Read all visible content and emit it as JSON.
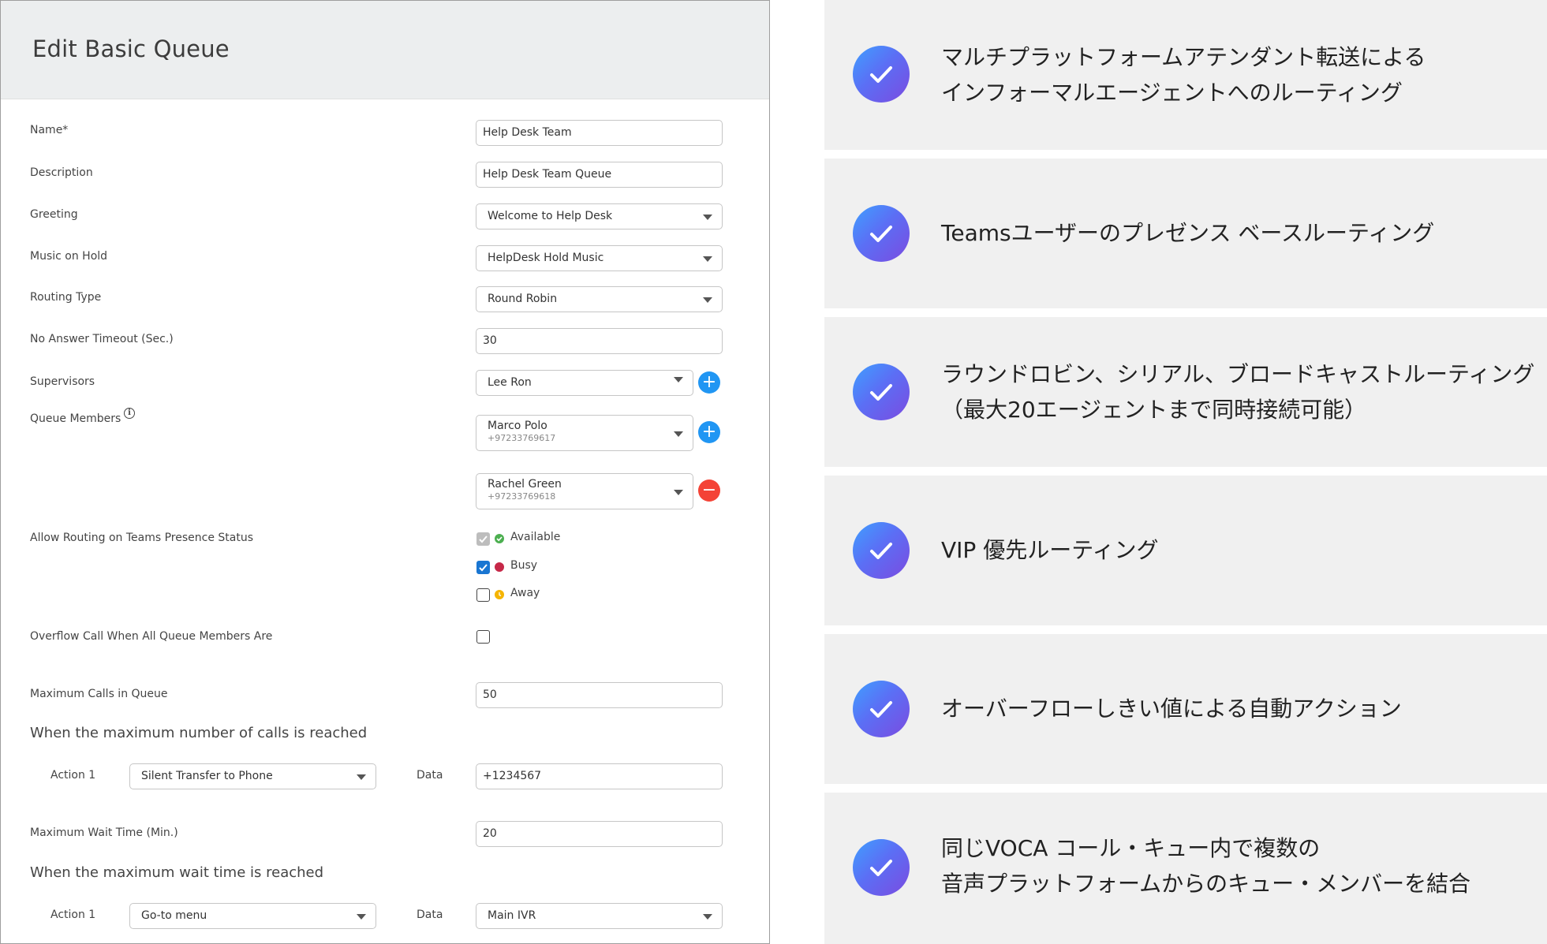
{
  "form": {
    "title": "Edit Basic Queue",
    "name_label": "Name*",
    "name_value": "Help Desk Team",
    "description_label": "Description",
    "description_value": "Help Desk Team Queue",
    "greeting_label": "Greeting",
    "greeting_value": "Welcome to Help Desk",
    "moh_label": "Music on Hold",
    "moh_value": "HelpDesk Hold Music",
    "routing_type_label": "Routing Type",
    "routing_type_value": "Round Robin",
    "timeout_label": "No Answer Timeout (Sec.)",
    "timeout_value": "30",
    "supervisors_label": "Supervisors",
    "supervisor_value": "Lee Ron",
    "queue_members_label": "Queue Members",
    "members": [
      {
        "name": "Marco Polo",
        "phone": "+97233769617"
      },
      {
        "name": "Rachel Green",
        "phone": "+97233769618"
      }
    ],
    "presence_label": "Allow Routing on Teams Presence Status",
    "presence": [
      {
        "label": "Available",
        "state": "disabled-checked",
        "color": "#4caf50"
      },
      {
        "label": "Busy",
        "state": "checked",
        "color": "#c62848"
      },
      {
        "label": "Away",
        "state": "unchecked",
        "color": "#f5b400"
      }
    ],
    "overflow_label": "Overflow Call When All Queue Members Are",
    "max_calls_label": "Maximum Calls in Queue",
    "max_calls_value": "50",
    "max_calls_reached_heading": "When the maximum number of calls is reached",
    "action1_label": "Action 1",
    "action1_value": "Silent Transfer to Phone",
    "data_label": "Data",
    "data1_value": "+1234567",
    "max_wait_label": "Maximum Wait Time (Min.)",
    "max_wait_value": "20",
    "max_wait_heading": "When the maximum wait time is reached",
    "action2_label": "Action 1",
    "action2_value": "Go-to menu",
    "data2_label": "Data",
    "data2_value": "Main IVR"
  },
  "features": [
    {
      "line1": "マルチプラットフォームアテンダント転送による",
      "line2": "インフォーマルエージェントへのルーティング"
    },
    {
      "line1": "Teamsユーザーのプレゼンス ベースルーティング",
      "line2": ""
    },
    {
      "line1": "ラウンドロビン、シリアル、ブロードキャストルーティング",
      "line2": "（最大20エージェントまで同時接続可能）"
    },
    {
      "line1": "VIP 優先ルーティング",
      "line2": ""
    },
    {
      "line1": "オーバーフローしきい値による自動アクション",
      "line2": ""
    },
    {
      "line1": "同じVOCA コール・キュー内で複数の",
      "line2": "音声プラットフォームからのキュー・メンバーを結合"
    }
  ],
  "colors": {
    "accent_blue": "#2196f3",
    "remove_red": "#f44336",
    "card_bg": "#f0f0f0",
    "check_gradient_start": "#3fa0ff",
    "check_gradient_end": "#7b4be0"
  },
  "icons": {
    "add": "plus-icon",
    "remove": "minus-icon",
    "info": "info-icon",
    "dropdown": "chevron-down-icon",
    "feature": "check-icon"
  }
}
